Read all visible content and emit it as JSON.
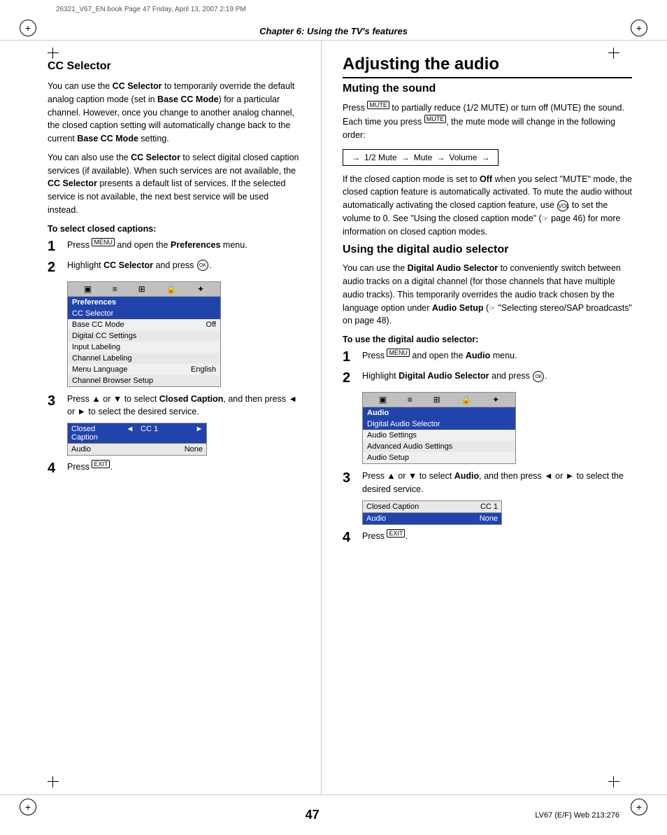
{
  "header": {
    "file_info": "26321_V67_EN.book  Page 47  Friday, April 13, 2007  2:19 PM",
    "chapter": "Chapter 6: Using the TV's features"
  },
  "footer": {
    "page_number": "47",
    "product_code": "LV67 (E/F)  Web 213:276"
  },
  "left_section": {
    "title": "CC Selector",
    "intro_p1": "You can use the CC Selector to temporarily override the default analog caption mode (set in Base CC Mode) for a particular channel. However, once you change to another analog channel, the closed caption setting will automatically change back to the current Base CC Mode setting.",
    "intro_p2": "You can also use the CC Selector to select digital closed caption services (if available). When such services are not available, the CC Selector presents a default list of services. If the selected service is not available, the next best service will be used instead.",
    "steps_label": "To select closed captions:",
    "step1": "Press",
    "step1b": "and open the",
    "step1c": "Preferences",
    "step1d": "menu.",
    "step2": "Highlight",
    "step2b": "CC Selector",
    "step2c": "and press",
    "step3": "Press ▲ or ▼ to select",
    "step3b": "Closed Caption",
    "step3c": ", and then press ◄ or ► to select the desired service.",
    "step4": "Press",
    "menu": {
      "icons": [
        "☐",
        "☰",
        "⊞",
        "🔒",
        "⚙"
      ],
      "title": "Preferences",
      "selected": "CC Selector",
      "rows": [
        {
          "label": "Base CC Mode",
          "value": "Off"
        },
        {
          "label": "Digital CC Settings",
          "value": ""
        },
        {
          "label": "Input Labeling",
          "value": ""
        },
        {
          "label": "Channel Labeling",
          "value": ""
        },
        {
          "label": "Menu Language",
          "value": "English"
        },
        {
          "label": "Channel Browser Setup",
          "value": ""
        }
      ]
    },
    "caption_table": {
      "col1_header": "Closed Caption",
      "col1_nav": "CC 1",
      "col2_header": "▄",
      "row2_col1": "Audio",
      "row2_col2": "None"
    }
  },
  "right_section": {
    "main_title": "Adjusting the audio",
    "muting_title": "Muting the sound",
    "muting_p1": "Press",
    "muting_p1b": "to partially reduce (1/2 MUTE) or turn off (MUTE) the sound. Each time you press",
    "muting_p1c": ", the mute mode will change in the following order:",
    "flow": {
      "item1": "1/2 Mute",
      "arrow1": "→",
      "item2": "Mute",
      "arrow2": "→",
      "item3": "Volume",
      "arrow3": "→"
    },
    "muting_p2": "If the closed caption mode is set to Off when you select \"MUTE\" mode, the closed caption feature is automatically activated. To mute the audio without automatically activating the closed caption feature, use",
    "muting_p2b": "to set the volume to 0. See \"Using the closed caption mode\" (",
    "muting_p2c": "page 46) for more information on closed caption modes.",
    "digital_title": "Using the digital audio selector",
    "digital_p1": "You can use the Digital Audio Selector to conveniently switch between audio tracks on a digital channel (for those channels that have multiple audio tracks). This temporarily overrides the audio track chosen by the language option under Audio Setup (",
    "digital_p1b": "\"Selecting stereo/SAP broadcasts\" on page 48).",
    "digital_steps_label": "To use the digital audio selector:",
    "step1": "Press",
    "step1b": "and open the",
    "step1c": "Audio",
    "step1d": "menu.",
    "step2": "Highlight",
    "step2b": "Digital Audio Selector",
    "step2c": "and press",
    "step3": "Press ▲ or ▼ to select",
    "step3b": "Audio",
    "step3c": ", and then press ◄ or ► to select the desired service.",
    "step4": "Press",
    "menu": {
      "icons": [
        "☐",
        "☰",
        "⊞",
        "🔒",
        "⚙"
      ],
      "title": "Audio",
      "selected": "Digital Audio Selector",
      "rows": [
        {
          "label": "Audio Settings",
          "value": ""
        },
        {
          "label": "Advanced Audio Settings",
          "value": ""
        },
        {
          "label": "Audio Setup",
          "value": ""
        }
      ]
    },
    "caption_table": {
      "col1_header": "Closed Caption",
      "col1_value": "CC 1",
      "col2_header": "Audio",
      "col2_value": "None"
    }
  }
}
